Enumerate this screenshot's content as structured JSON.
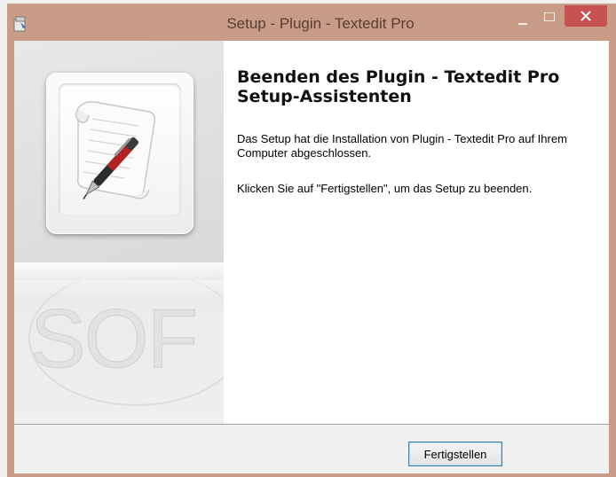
{
  "window": {
    "title": "Setup - Plugin - Textedit Pro"
  },
  "sidebar": {
    "watermark_text": "SOF"
  },
  "main": {
    "heading": "Beenden des Plugin - Textedit Pro Setup-Assistenten",
    "paragraph_1": "Das Setup hat die Installation von Plugin - Textedit Pro auf Ihrem Computer abgeschlossen.",
    "paragraph_2": "Klicken Sie auf \"Fertigstellen\", um das Setup zu beenden."
  },
  "footer": {
    "finish_label": "Fertigstellen"
  },
  "icons": {
    "app_icon": "setup-installer-icon",
    "sidebar_image": "paper-scroll-pen-icon"
  },
  "colors": {
    "titlebar": "#c89c87",
    "close_button": "#c75050",
    "button_border": "#3c7fb1"
  }
}
